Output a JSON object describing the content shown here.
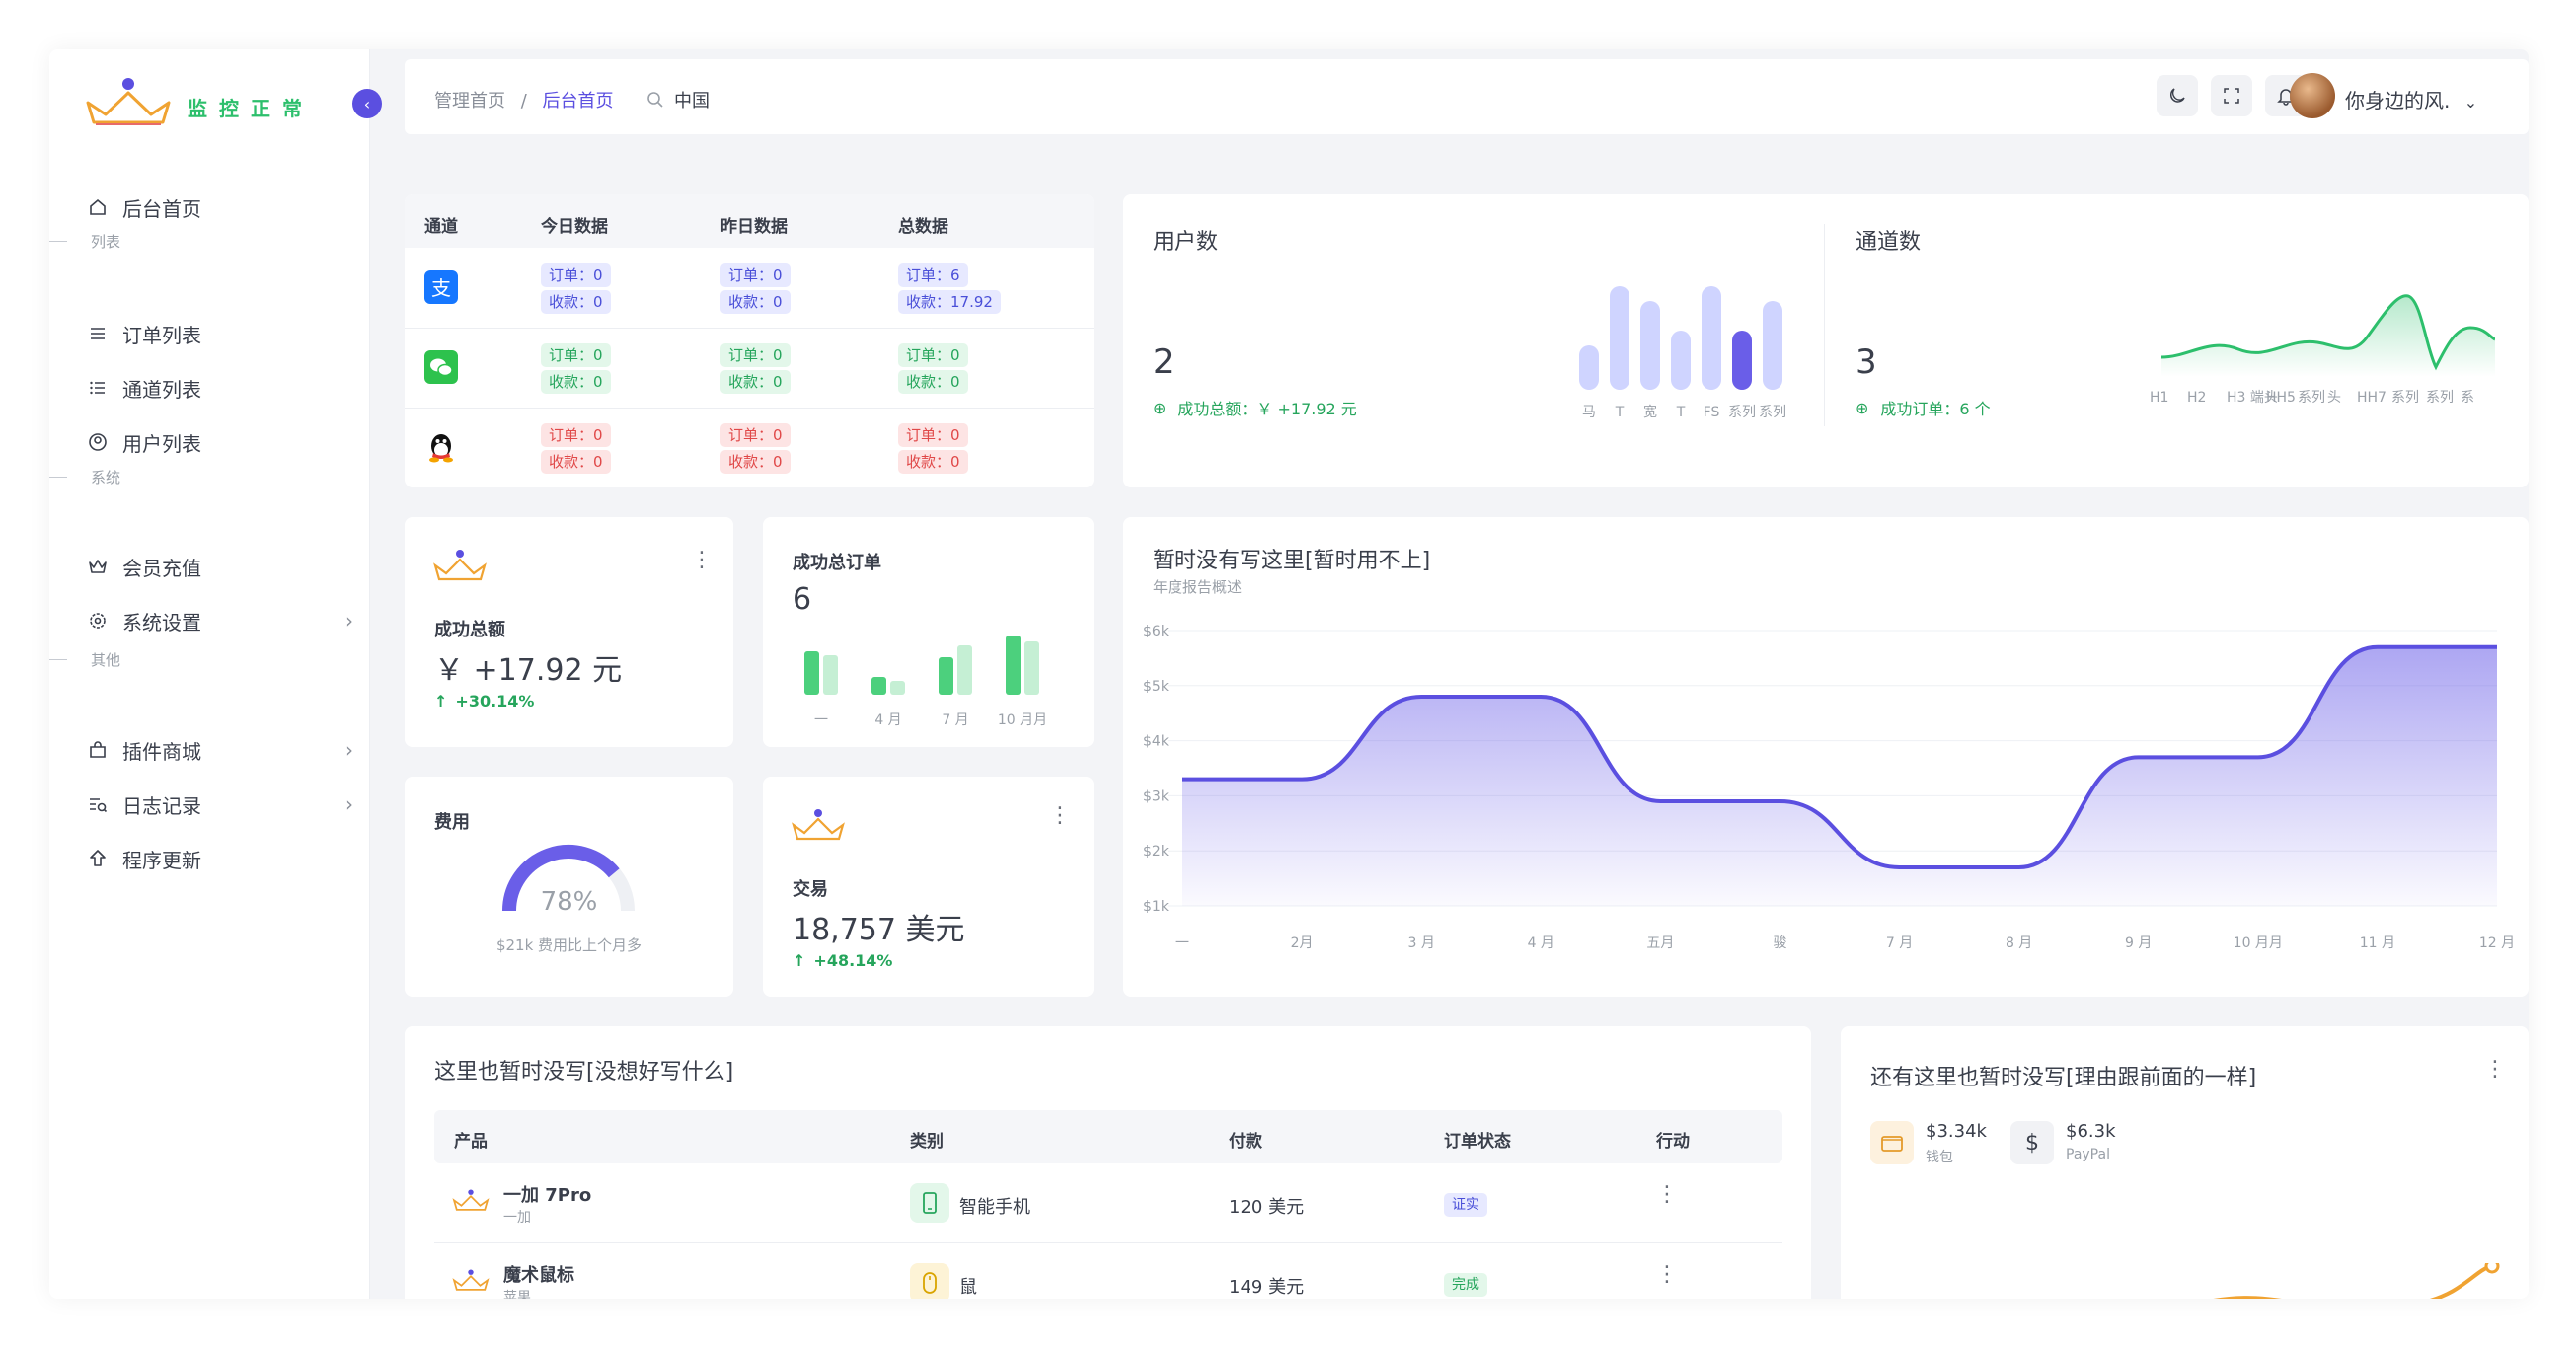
{
  "brand": "监控正常",
  "nav": {
    "home": "后台首页",
    "section_list": "列表",
    "orders": "订单列表",
    "channels": "通道列表",
    "users": "用户列表",
    "section_system": "系统",
    "recharge": "会员充值",
    "settings": "系统设置",
    "section_other": "其他",
    "plugins": "插件商城",
    "logs": "日志记录",
    "update": "程序更新"
  },
  "topbar": {
    "breadcrumb_root": "管理首页",
    "breadcrumb_sep": "/",
    "breadcrumb_current": "后台首页",
    "search_value": "中国",
    "username": "你身边的风."
  },
  "channel_table": {
    "headers": [
      "通道",
      "今日数据",
      "昨日数据",
      "总数据"
    ],
    "rows": [
      {
        "icon": "alipay-icon",
        "cells": [
          [
            "订单：0",
            "收款：0"
          ],
          [
            "订单：0",
            "收款：0"
          ],
          [
            "订单：6",
            "收款：17.92"
          ]
        ],
        "tone": "blue"
      },
      {
        "icon": "wechat-icon",
        "cells": [
          [
            "订单：0",
            "收款：0"
          ],
          [
            "订单：0",
            "收款：0"
          ],
          [
            "订单：0",
            "收款：0"
          ]
        ],
        "tone": "green"
      },
      {
        "icon": "qq-icon",
        "cells": [
          [
            "订单：0",
            "收款：0"
          ],
          [
            "订单：0",
            "收款：0"
          ],
          [
            "订单：0",
            "收款：0"
          ]
        ],
        "tone": "red"
      }
    ]
  },
  "users_card": {
    "title": "用户数",
    "value": "2",
    "sub": "成功总额：￥ +17.92 元",
    "bar_values": [
      3,
      7,
      6,
      4,
      7,
      4,
      6
    ],
    "bar_labels": [
      "马",
      "T",
      "宽",
      "T",
      "FS",
      "系列",
      "系列"
    ]
  },
  "channels_card": {
    "title": "通道数",
    "value": "3",
    "sub": "成功订单：6 个",
    "line_labels": [
      "H1",
      "H2",
      "H3 端头",
      "HH5",
      "系列",
      "头",
      "HH7",
      "系列",
      "系列",
      "系"
    ]
  },
  "success_total": {
    "title": "成功总额",
    "value": "￥ +17.92 元",
    "change": "+30.14%"
  },
  "success_orders": {
    "title": "成功总订单",
    "value": "6",
    "labels": [
      "一",
      "4 月",
      "7 月",
      "10 月月"
    ]
  },
  "fee_card": {
    "title": "费用",
    "percent": 78,
    "percent_label": "78%",
    "sub": "$21k 费用比上个月多"
  },
  "trade_card": {
    "title": "交易",
    "value": "18,757 美元",
    "change": "+48.14%"
  },
  "area_chart_card": {
    "title": "暂时没有写这里[暂时用不上]",
    "subtitle": "年度报告概述"
  },
  "chart_data": {
    "type": "area",
    "categories": [
      "一",
      "2月",
      "3 月",
      "4 月",
      "五月",
      "骏",
      "7 月",
      "8 月",
      "9 月",
      "10 月月",
      "11 月",
      "12 月"
    ],
    "values": [
      3.3,
      3.3,
      4.8,
      4.8,
      2.9,
      2.9,
      1.7,
      1.7,
      3.7,
      3.7,
      5.7,
      5.7
    ],
    "ylim": [
      1,
      6
    ],
    "y_ticks": [
      "$6k",
      "$5k",
      "$4k",
      "$3k",
      "$2k",
      "$1k"
    ],
    "grid": true
  },
  "products_card": {
    "title": "这里也暂时没写[没想好写什么]",
    "headers": [
      "产品",
      "类别",
      "付款",
      "订单状态",
      "行动"
    ],
    "rows": [
      {
        "name": "一加 7Pro",
        "brand": "一加",
        "category": "智能手机",
        "cat_icon": "phone-icon",
        "price": "120 美元",
        "status": "证实",
        "status_tone": "blue"
      },
      {
        "name": "魔术鼠标",
        "brand": "苹果",
        "category": "鼠",
        "cat_icon": "mouse-icon",
        "price": "149 美元",
        "status": "完成",
        "status_tone": "green"
      }
    ]
  },
  "wallet_card": {
    "title": "还有这里也暂时没写[理由跟前面的一样]",
    "wallet_value": "$3.34k",
    "wallet_label": "钱包",
    "paypal_value": "$6.3k",
    "paypal_label": "PayPal"
  },
  "colors": {
    "accent": "#5b4fe0",
    "green": "#2dbf6c",
    "orange": "#f0a332"
  }
}
